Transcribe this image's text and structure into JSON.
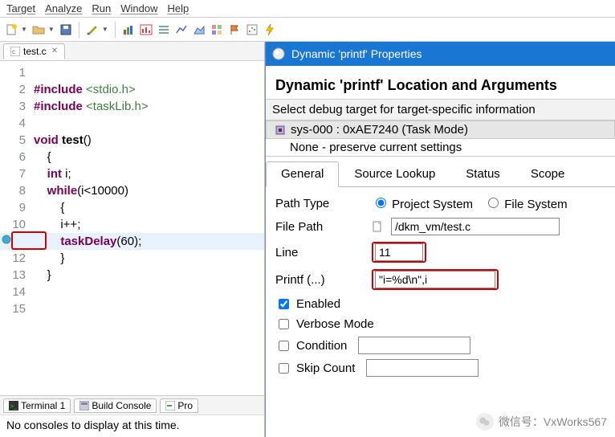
{
  "menubar": [
    "Target",
    "Analyze",
    "Run",
    "Window",
    "Help"
  ],
  "editor_tab": "test.c",
  "code_lines": [
    {
      "n": 1,
      "text": ""
    },
    {
      "n": 2,
      "html": "<span class='kw'>#include</span> <span class='hdr'>&lt;stdio.h&gt;</span>"
    },
    {
      "n": 3,
      "html": "<span class='kw'>#include</span> <span class='hdr'>&lt;taskLib.h&gt;</span>"
    },
    {
      "n": 4,
      "text": ""
    },
    {
      "n": 5,
      "html": "<span class='kw'>void</span> <span class='fn'>test</span>()"
    },
    {
      "n": 6,
      "text": "    {"
    },
    {
      "n": 7,
      "html": "    <span class='kw'>int</span> i;"
    },
    {
      "n": 8,
      "html": "    <span class='kw'>while</span>(i&lt;10000)"
    },
    {
      "n": 9,
      "text": "        {"
    },
    {
      "n": 10,
      "text": "        i++;"
    },
    {
      "n": 11,
      "html": "        <span class='tdelay'>taskDelay</span>(60);"
    },
    {
      "n": 12,
      "text": "        }"
    },
    {
      "n": 13,
      "text": "    }"
    },
    {
      "n": 14,
      "text": ""
    },
    {
      "n": 15,
      "text": ""
    }
  ],
  "breakpoint_line": 11,
  "bottom_tabs": [
    "Terminal 1",
    "Build Console",
    "Pro"
  ],
  "console_text": "No consoles to display at this time.",
  "dialog": {
    "title": "Dynamic 'printf' Properties",
    "headline": "Dynamic 'printf' Location and Arguments",
    "instr": "Select debug target for target-specific information",
    "targets": [
      "sys-000 : 0xAE7240 (Task Mode)",
      "None - preserve current settings"
    ],
    "tabs": [
      "General",
      "Source Lookup",
      "Status",
      "Scope"
    ],
    "form": {
      "path_type_label": "Path Type",
      "path_type_project": "Project System",
      "path_type_file": "File System",
      "file_path_label": "File Path",
      "file_path_value": "/dkm_vm/test.c",
      "line_label": "Line",
      "line_value": "11",
      "printf_label": "Printf (...)",
      "printf_value": "\"i=%d\\n\",i",
      "enabled_label": "Enabled",
      "verbose_label": "Verbose Mode",
      "condition_label": "Condition",
      "skip_label": "Skip Count"
    }
  },
  "watermark": "微信号：VxWorks567"
}
